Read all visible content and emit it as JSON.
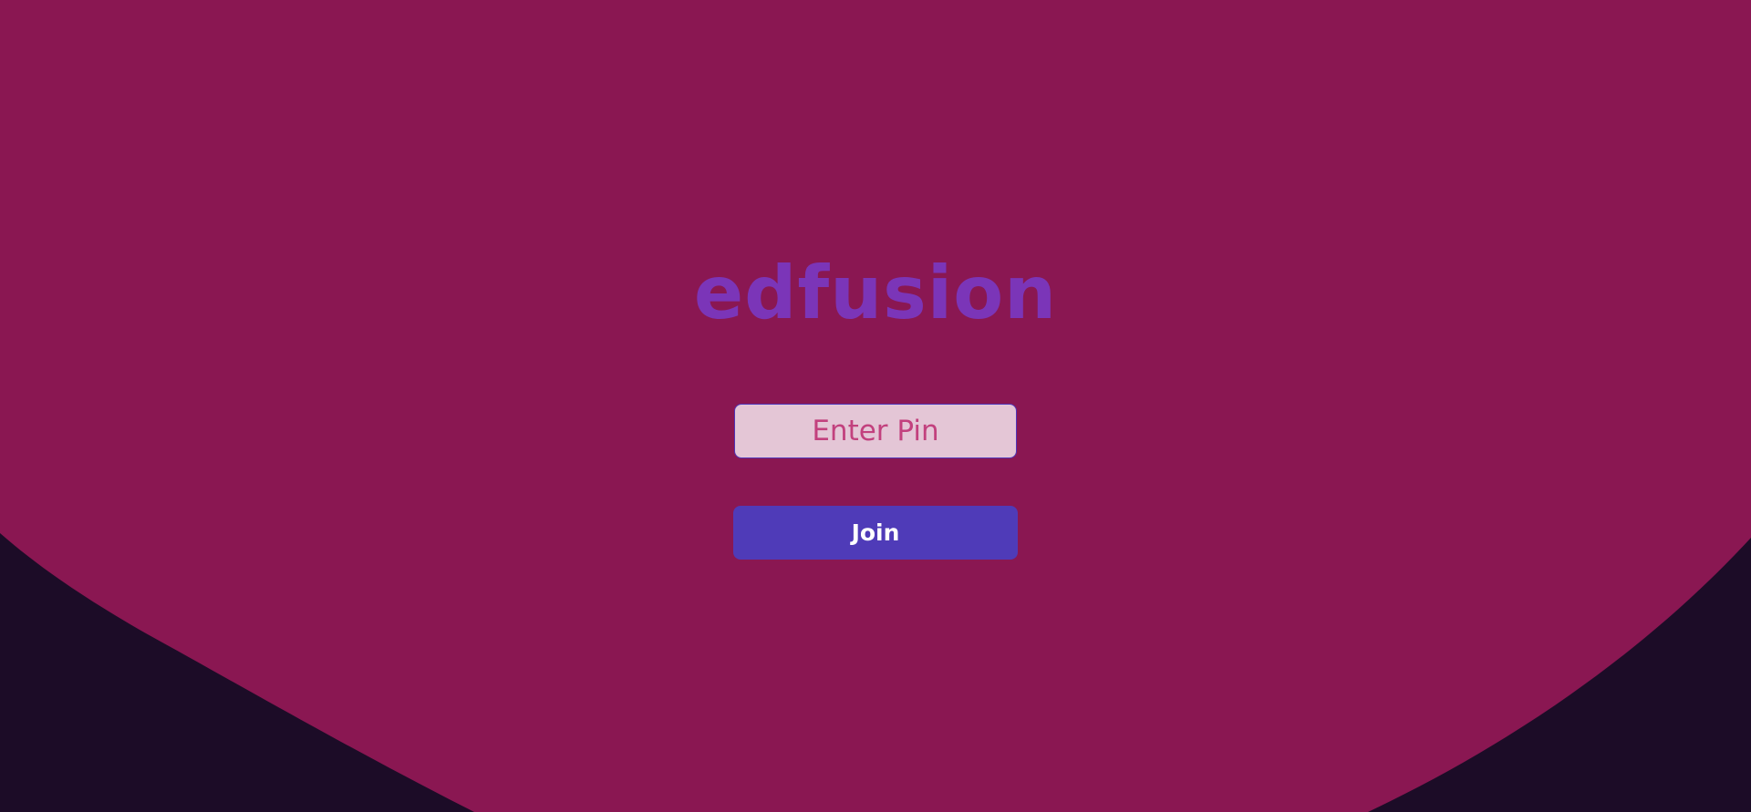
{
  "app": {
    "logo_text": "edfusion"
  },
  "form": {
    "pin_placeholder": "Enter Pin",
    "pin_value": "",
    "join_label": "Join"
  },
  "colors": {
    "background_primary": "#8a1752",
    "background_dark": "#1c0c27",
    "logo": "#7b35b8",
    "input_bg": "#e4c6d6",
    "input_text": "#c2417e",
    "button_bg": "#4f3bb8",
    "button_text": "#ffffff"
  }
}
